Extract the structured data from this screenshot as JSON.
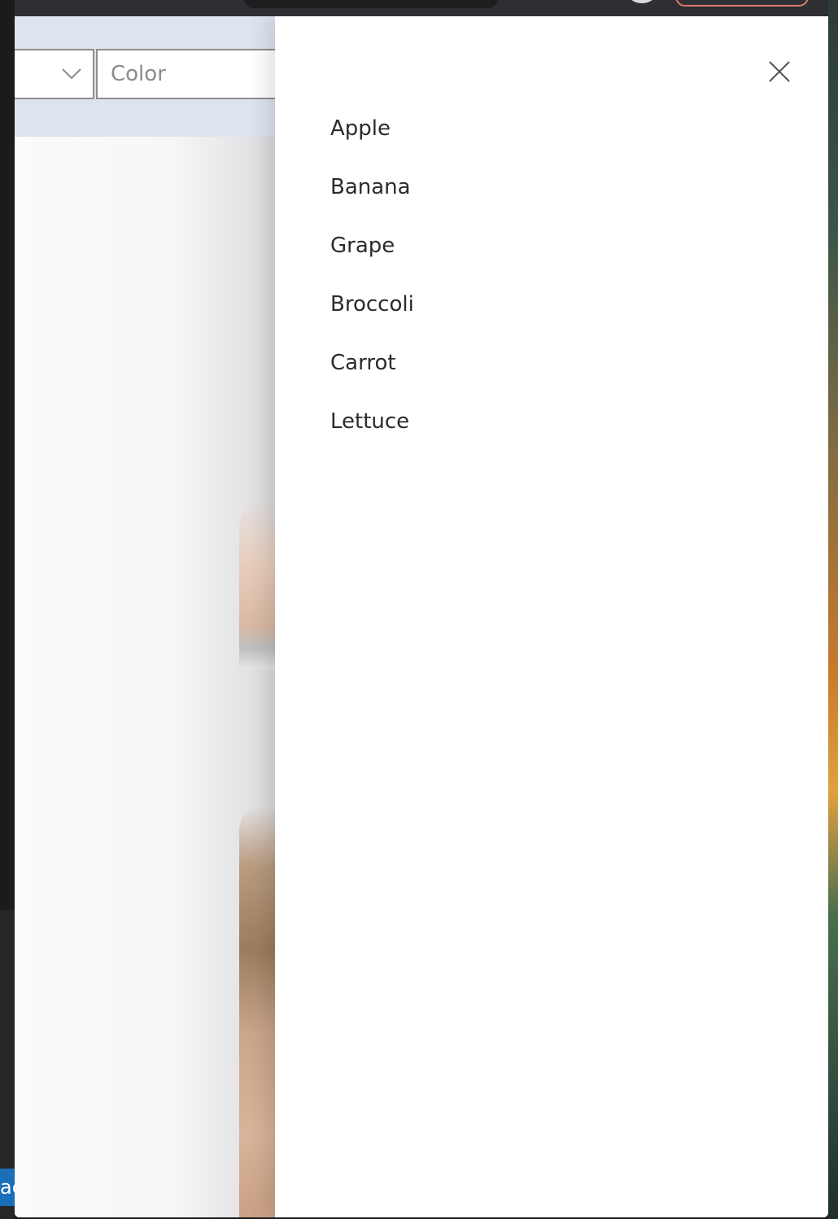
{
  "filters": {
    "color_placeholder": "Color"
  },
  "menu": {
    "items": [
      {
        "label": "Apple"
      },
      {
        "label": "Banana"
      },
      {
        "label": "Grape"
      },
      {
        "label": "Broccoli"
      },
      {
        "label": "Carrot"
      },
      {
        "label": "Lettuce"
      }
    ]
  },
  "icons": {
    "close": "close-icon",
    "dropdown": "chevron-down-icon"
  },
  "os": {
    "left_tab_text": "ac"
  },
  "colors": {
    "filter_band": "#dde4ee",
    "text": "#2b2b2b",
    "placeholder": "#8c8c8c",
    "border": "#8e8e8e"
  }
}
